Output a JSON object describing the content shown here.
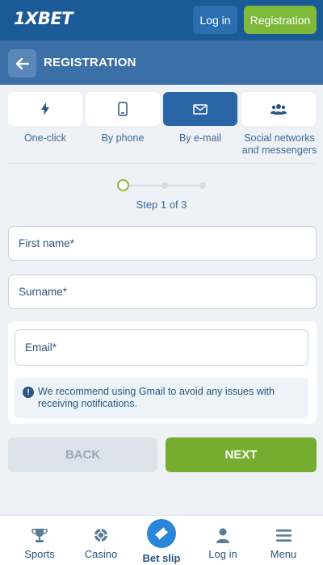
{
  "header": {
    "logo_prefix": "1X",
    "logo_suffix": "BET",
    "login_label": "Log in",
    "registration_label": "Registration"
  },
  "registration_bar": {
    "title": "REGISTRATION",
    "back_icon": "arrow-left-icon"
  },
  "methods": [
    {
      "label": "One-click",
      "icon": "lightning-icon",
      "active": false
    },
    {
      "label": "By phone",
      "icon": "phone-icon",
      "active": false
    },
    {
      "label": "By e-mail",
      "icon": "envelope-icon",
      "active": true
    },
    {
      "label_line1": "Social networks",
      "label_line2": "and messengers",
      "icon": "users-icon",
      "active": false
    }
  ],
  "progress": {
    "current_step": 1,
    "total_steps": 3,
    "label": "Step 1 of 3"
  },
  "form": {
    "first_name_placeholder": "First name*",
    "surname_placeholder": "Surname*",
    "email_placeholder": "Email*",
    "notice_icon": "info-icon",
    "notice_text": "We recommend using Gmail to avoid any issues with receiving notifications."
  },
  "actions": {
    "back_label": "BACK",
    "next_label": "NEXT"
  },
  "bottom_nav": [
    {
      "label": "Sports",
      "icon": "trophy-icon"
    },
    {
      "label": "Casino",
      "icon": "chip-icon"
    },
    {
      "label": "Bet slip",
      "icon": "ticket-icon",
      "highlighted": true
    },
    {
      "label": "Log in",
      "icon": "user-icon"
    },
    {
      "label": "Menu",
      "icon": "hamburger-icon"
    }
  ],
  "colors": {
    "brand_blue": "#1a5a96",
    "accent_green": "#76ad30",
    "active_tab": "#2a65a8"
  }
}
